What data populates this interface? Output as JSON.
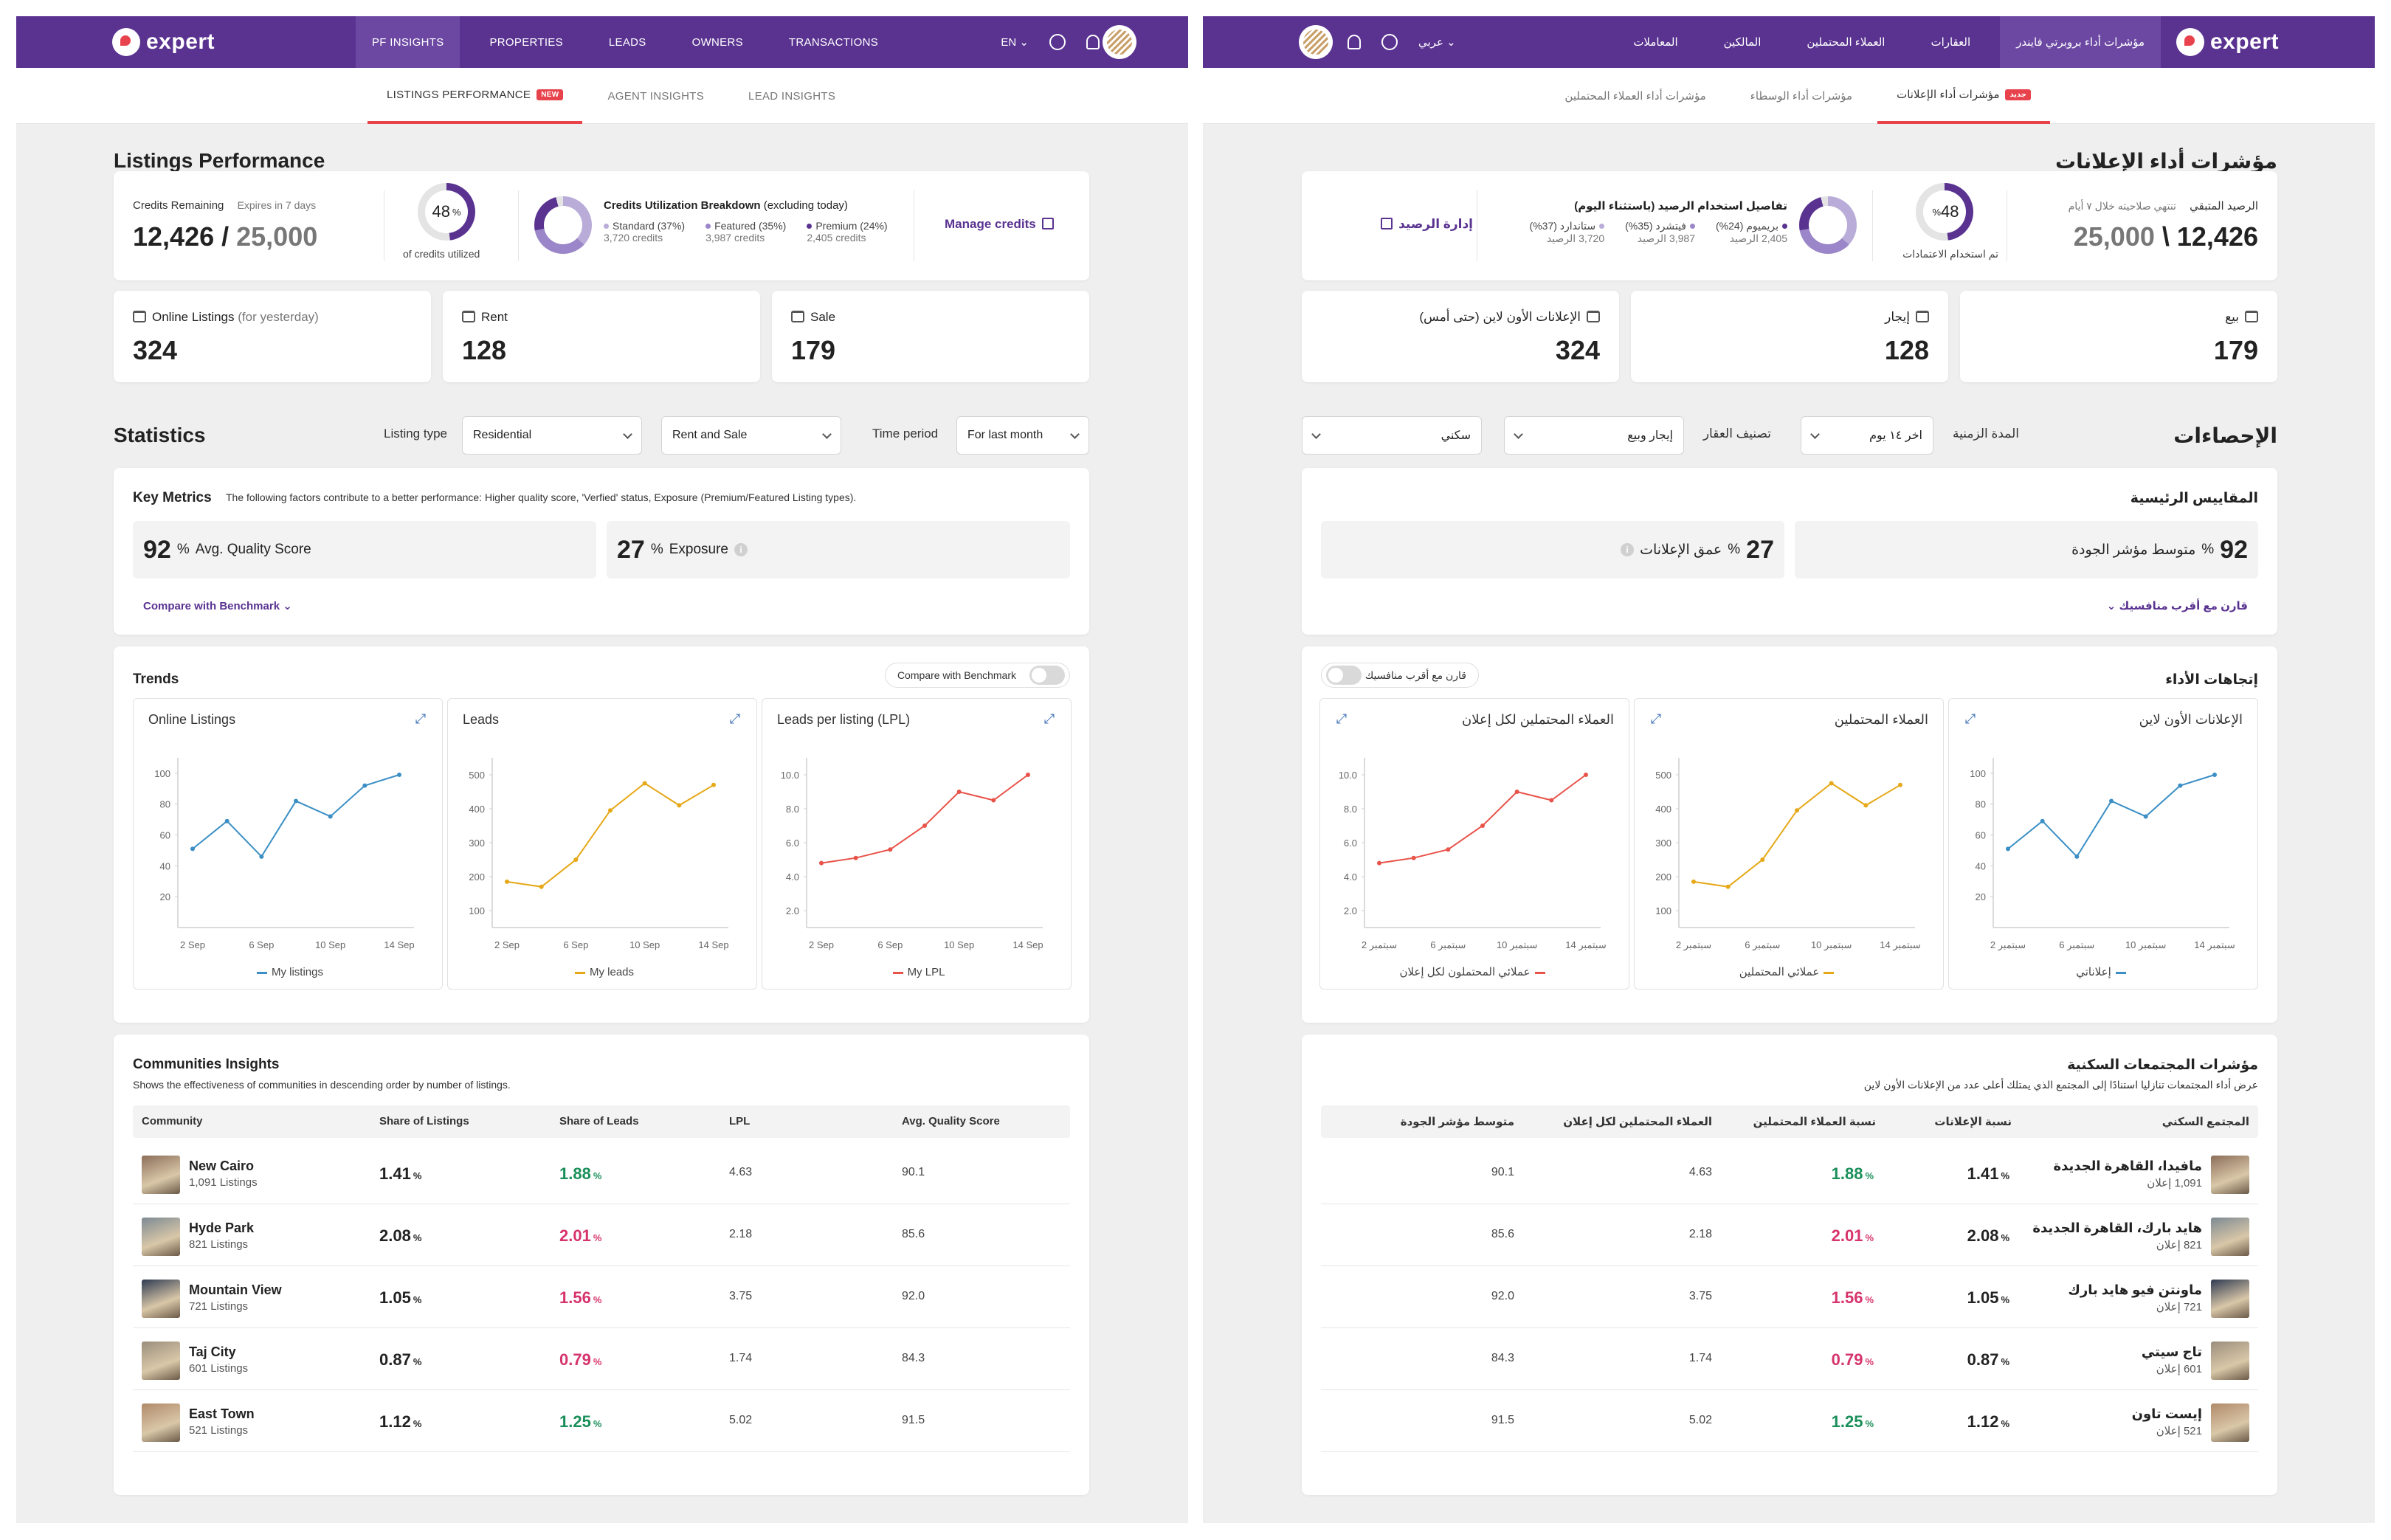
{
  "en": {
    "brand": "expert",
    "nav": [
      "PF INSIGHTS",
      "PROPERTIES",
      "LEADS",
      "OWNERS",
      "TRANSACTIONS"
    ],
    "lang": "EN",
    "subtabs": [
      "LISTINGS PERFORMANCE",
      "AGENT INSIGHTS",
      "LEAD INSIGHTS"
    ],
    "new_badge": "NEW",
    "page_title": "Listings Performance",
    "credits": {
      "label": "Credits Remaining",
      "expires": "Expires in 7 days",
      "remaining": "12,426",
      "slash": " / ",
      "total": "25,000",
      "utilized_pct": "48",
      "pct_sign": "%",
      "utilized_label": "of credits utilized",
      "breakdown_title": "Credits Utilization Breakdown",
      "breakdown_note": "(excluding today)",
      "manage": "Manage credits",
      "items": [
        {
          "name": "Standard (37%)",
          "value": "3,720 credits",
          "color": "#b9acd8"
        },
        {
          "name": "Featured (35%)",
          "value": "3,987 credits",
          "color": "#9a86c8"
        },
        {
          "name": "Premium (24%)",
          "value": "2,405 credits",
          "color": "#5a3391"
        }
      ]
    },
    "stats_cards": [
      {
        "label": "Online Listings",
        "note": "(for yesterday)",
        "value": "324"
      },
      {
        "label": "Rent",
        "note": "",
        "value": "128"
      },
      {
        "label": "Sale",
        "note": "",
        "value": "179"
      }
    ],
    "statistics": {
      "title": "Statistics",
      "listing_type_label": "Listing type",
      "listing_type": "Residential",
      "category": "Rent and Sale",
      "time_label": "Time period",
      "time": "For last month"
    },
    "key_metrics": {
      "title": "Key Metrics",
      "desc": "The following factors contribute to a better performance: Higher quality score, 'Verfied' status, Exposure (Premium/Featured Listing types).",
      "quality_value": "92",
      "quality_label": "Avg. Quality Score",
      "exposure_value": "27",
      "exposure_label": "Exposure",
      "pct": "%",
      "compare": "Compare with Benchmark"
    },
    "trends": {
      "title": "Trends",
      "compare": "Compare with Benchmark",
      "charts": [
        {
          "title": "Online Listings",
          "legend": "My listings"
        },
        {
          "title": "Leads",
          "legend": "My leads"
        },
        {
          "title": "Leads per listing (LPL)",
          "legend": "My LPL"
        }
      ]
    },
    "communities": {
      "title": "Communities Insights",
      "desc": "Shows the effectiveness of communities in descending order by number of listings.",
      "headers": [
        "Community",
        "Share of Listings",
        "Share of Leads",
        "LPL",
        "Avg. Quality Score"
      ],
      "rows": [
        {
          "name": "New Cairo",
          "listings": "1,091 Listings",
          "share_listings": "1.41",
          "share_leads": "1.88",
          "lpl": "4.63",
          "quality": "90.1"
        },
        {
          "name": "Hyde Park",
          "listings": "821 Listings",
          "share_listings": "2.08",
          "share_leads": "2.01",
          "lpl": "2.18",
          "quality": "85.6"
        },
        {
          "name": "Mountain View",
          "listings": "721 Listings",
          "share_listings": "1.05",
          "share_leads": "1.56",
          "lpl": "3.75",
          "quality": "92.0"
        },
        {
          "name": "Taj City",
          "listings": "601 Listings",
          "share_listings": "0.87",
          "share_leads": "0.79",
          "lpl": "1.74",
          "quality": "84.3"
        },
        {
          "name": "East Town",
          "listings": "521 Listings",
          "share_listings": "1.12",
          "share_leads": "1.25",
          "lpl": "5.02",
          "quality": "91.5"
        }
      ]
    }
  },
  "ar": {
    "brand": "expert",
    "nav": [
      "مؤشرات أداء بروبرتي فايندر",
      "العقارات",
      "العملاء المحتملين",
      "المالكين",
      "المعاملات"
    ],
    "lang": "عربي",
    "subtabs": [
      "مؤشرات أداء الإعلانات",
      "مؤشرات أداء الوسطاء",
      "مؤشرات أداء العملاء المحتملين"
    ],
    "new_badge": "جديد",
    "page_title": "مؤشرات أداء الإعلانات",
    "credits": {
      "label": "الرصيد المتبقي",
      "expires": "تنتهي صلاحيته خلال ٧ أيام",
      "remaining": "12,426",
      "slash": " \\ ",
      "total": "25,000",
      "utilized_pct": "48",
      "pct_sign": "%",
      "utilized_label": "تم استخدام الاعتمادات",
      "breakdown_title": "تفاصيل استخدام الرصيد (باستثناء اليوم)",
      "manage": "إدارة الرصيد",
      "items": [
        {
          "name": "بريميوم (24%)",
          "value": "2,405 الرصيد",
          "color": "#5a3391"
        },
        {
          "name": "فيتشرد (35%)",
          "value": "3,987 الرصيد",
          "color": "#9a86c8"
        },
        {
          "name": "ستاندارد (37%)",
          "value": "3,720 الرصيد",
          "color": "#b9acd8"
        }
      ]
    },
    "stats_cards": [
      {
        "label": "بيع",
        "note": "",
        "value": "179"
      },
      {
        "label": "إيجار",
        "note": "",
        "value": "128"
      },
      {
        "label": "الإعلانات الأون لاين (حتى أمس)",
        "note": "",
        "value": "324"
      }
    ],
    "statistics": {
      "title": "الإحصاءات",
      "time_label": "المدة الزمنية",
      "time": "اخر ١٤ يوم",
      "category_label": "تصنيف العقار",
      "category": "إيجار وبيع",
      "listing_type": "سكني"
    },
    "key_metrics": {
      "title": "المقاييس الرئيسية",
      "quality_value": "92",
      "quality_label": "متوسط مؤشر الجودة",
      "exposure_value": "27",
      "exposure_label": "عمق الإعلانات",
      "pct": "%",
      "compare": "قارن مع أقرب منافسيك"
    },
    "trends": {
      "title": "إتجاهات الأداء",
      "compare": "قارن مع أقرب منافسيك",
      "charts": [
        {
          "title": "الإعلانات الأون لاين",
          "legend": "إعلاناتي"
        },
        {
          "title": "العملاء المحتملين",
          "legend": "عملائي المحتملين"
        },
        {
          "title": "العملاء المحتملين لكل إعلان",
          "legend": "عملائي المحتملون لكل إعلان"
        }
      ]
    },
    "communities": {
      "title": "مؤشرات المجتمعات السكنية",
      "desc": "عرض أداء المجتمعات تنازليا استنادًا إلى المجتمع الذي يمتلك أعلى عدد من الإعلانات الأون لاين",
      "headers": [
        "المجتمع السكني",
        "نسبة الإعلانات",
        "نسبة العملاء المحتملين",
        "العملاء المحتملين لكل إعلان",
        "متوسط مؤشر الجودة"
      ],
      "rows": [
        {
          "name": "مافيدا، القاهرة الجديدة",
          "listings": "1,091",
          "listings_unit": "إعلان",
          "share_listings": "1.41",
          "share_leads": "1.88",
          "lpl": "4.63",
          "quality": "90.1"
        },
        {
          "name": "هايد بارك، القاهرة الجديدة",
          "listings": "821",
          "listings_unit": "إعلان",
          "share_listings": "2.08",
          "share_leads": "2.01",
          "lpl": "2.18",
          "quality": "85.6"
        },
        {
          "name": "ماونتن فيو هايد بارك",
          "listings": "721",
          "listings_unit": "إعلان",
          "share_listings": "1.05",
          "share_leads": "1.56",
          "lpl": "3.75",
          "quality": "92.0"
        },
        {
          "name": "تاج سيتي",
          "listings": "601",
          "listings_unit": "إعلان",
          "share_listings": "0.87",
          "share_leads": "0.79",
          "lpl": "1.74",
          "quality": "84.3"
        },
        {
          "name": "إيست تاون",
          "listings": "521",
          "listings_unit": "إعلان",
          "share_listings": "1.12",
          "share_leads": "1.25",
          "lpl": "5.02",
          "quality": "91.5"
        }
      ]
    }
  },
  "leads_trend": [
    "up",
    "down",
    "down",
    "down",
    "up"
  ],
  "chart_data": [
    {
      "type": "line",
      "name": "Online Listings",
      "x": [
        "2 Sep",
        "3 Sep",
        "4 Sep",
        "5 Sep",
        "6 Sep",
        "7 Sep",
        "8 Sep",
        "9 Sep",
        "10 Sep",
        "11 Sep",
        "12 Sep",
        "13 Sep",
        "14 Sep"
      ],
      "xticks_en": [
        "2 Sep",
        "6 Sep",
        "10 Sep",
        "14 Sep"
      ],
      "xticks_ar": [
        "2 سبتمبر",
        "6 سبتمبر",
        "10 سبتمبر",
        "14 سبتمبر"
      ],
      "points": [
        [
          0,
          51
        ],
        [
          1,
          69
        ],
        [
          2,
          46
        ],
        [
          3,
          82
        ],
        [
          4,
          72
        ],
        [
          5,
          92
        ],
        [
          6,
          99
        ]
      ],
      "yticks": [
        "100",
        "80",
        "60",
        "40",
        "20"
      ],
      "ymin": 0,
      "ymax": 110,
      "color": "#3b8fc4"
    },
    {
      "type": "line",
      "name": "Leads",
      "xticks_en": [
        "2 Sep",
        "6 Sep",
        "10 Sep",
        "14 Sep"
      ],
      "xticks_ar": [
        "2 سبتمبر",
        "6 سبتمبر",
        "10 سبتمبر",
        "14 سبتمبر"
      ],
      "points": [
        [
          0,
          185
        ],
        [
          1,
          170
        ],
        [
          2,
          250
        ],
        [
          3,
          395
        ],
        [
          4,
          475
        ],
        [
          5,
          410
        ],
        [
          6,
          470
        ]
      ],
      "yticks": [
        "500",
        "400",
        "300",
        "200",
        "100"
      ],
      "ymin": 50,
      "ymax": 550,
      "color": "#e6a817"
    },
    {
      "type": "line",
      "name": "Leads per listing (LPL)",
      "xticks_en": [
        "2 Sep",
        "6 Sep",
        "10 Sep",
        "14 Sep"
      ],
      "xticks_ar": [
        "2 سبتمبر",
        "6 سبتمبر",
        "10 سبتمبر",
        "14 سبتمبر"
      ],
      "points": [
        [
          0,
          4.8
        ],
        [
          1,
          5.1
        ],
        [
          2,
          5.6
        ],
        [
          3,
          7.0
        ],
        [
          4,
          9.0
        ],
        [
          5,
          8.5
        ],
        [
          6,
          10.0
        ]
      ],
      "yticks": [
        "10.0",
        "8.0",
        "6.0",
        "4.0",
        "2.0"
      ],
      "ymin": 1.0,
      "ymax": 11.0,
      "color": "#e8534a"
    }
  ],
  "colors": {
    "nav": "#5a3391",
    "accent": "#e8424c",
    "green": "#1a8f5a",
    "red": "#d6336c"
  },
  "thumbs": [
    "#8c6e5a",
    "#7d8a93",
    "#2f3b52",
    "#9a8e7c",
    "#b08a6a"
  ]
}
